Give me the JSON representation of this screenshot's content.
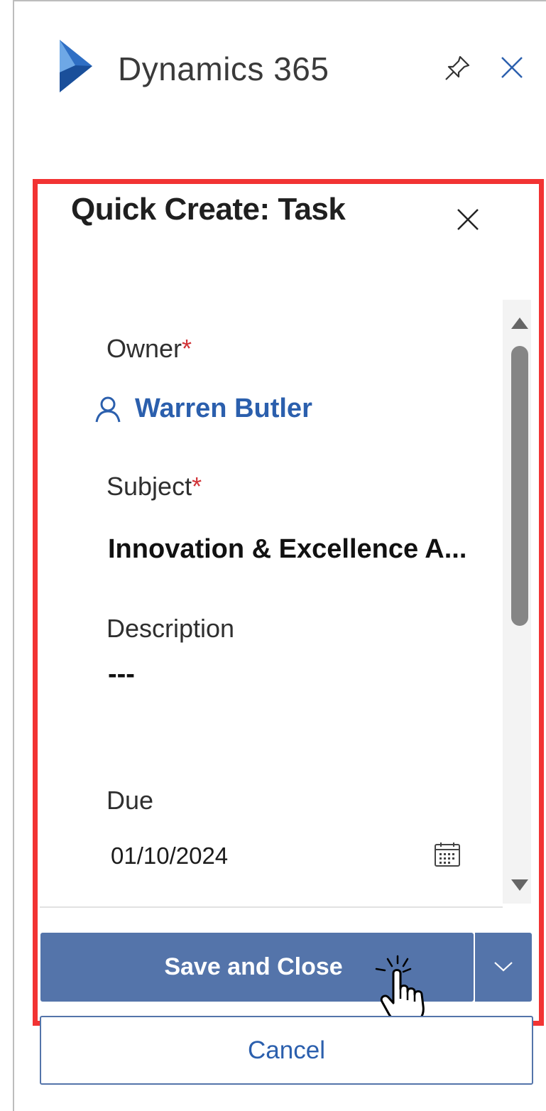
{
  "app": {
    "title": "Dynamics 365",
    "brand_color": "#2264ad"
  },
  "quick_create": {
    "title": "Quick Create: Task",
    "fields": {
      "owner": {
        "label": "Owner",
        "required_mark": "*",
        "value": "Warren Butler"
      },
      "subject": {
        "label": "Subject",
        "required_mark": "*",
        "value": "Innovation & Excellence A..."
      },
      "description": {
        "label": "Description",
        "value": "---"
      },
      "due": {
        "label": "Due",
        "value": "01/10/2024"
      }
    },
    "buttons": {
      "save_close": "Save and Close",
      "cancel": "Cancel"
    }
  },
  "colors": {
    "accent": "#5474aa",
    "link": "#2b5fad",
    "required": "#d13438",
    "highlight": "#f23333"
  },
  "icons": [
    "dynamics-logo-icon",
    "pin-icon",
    "close-icon",
    "person-icon",
    "calendar-icon",
    "chevron-down-icon",
    "hand-pointer-icon"
  ]
}
